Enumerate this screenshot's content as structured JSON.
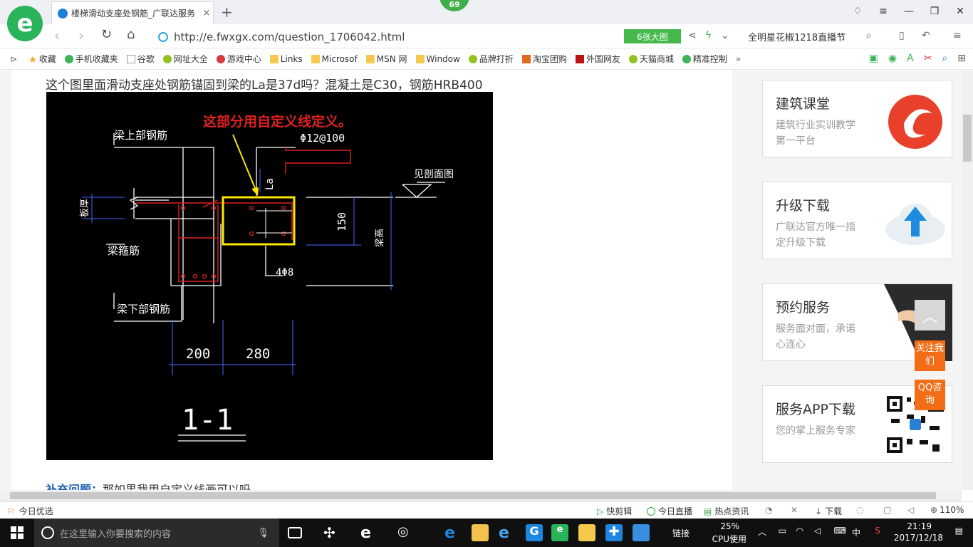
{
  "browser": {
    "tab_title": "楼梯滑动支座处钢筋_广联达服务",
    "tab_close": "×",
    "new_tab": "+",
    "badge": "69",
    "url": "http://e.fwxgx.com/question_1706042.html",
    "big_image_label": "6张大图",
    "hot_search": "全明星花椒1218直播节"
  },
  "bookmarks": [
    {
      "label": "收藏",
      "icon": "star-icon"
    },
    {
      "label": "手机收藏夹",
      "icon": "phone-icon"
    },
    {
      "label": "谷歌",
      "icon": "page-icon"
    },
    {
      "label": "网址大全",
      "icon": "globe-icon"
    },
    {
      "label": "游戏中心",
      "icon": "game-icon"
    },
    {
      "label": "Links",
      "icon": "folder-icon"
    },
    {
      "label": "Microsof",
      "icon": "folder-icon"
    },
    {
      "label": "MSN 网",
      "icon": "folder-icon"
    },
    {
      "label": "Window",
      "icon": "folder-icon"
    },
    {
      "label": "品牌打折",
      "icon": "leaf-icon"
    },
    {
      "label": "淘宝团购",
      "icon": "taobao-icon"
    },
    {
      "label": "外国网友",
      "icon": "flag-icon"
    },
    {
      "label": "天猫商城",
      "icon": "leaf-icon"
    },
    {
      "label": "精准控制",
      "icon": "wechat-icon"
    }
  ],
  "question": {
    "title": "这个图里面滑动支座处钢筋锚固到梁的La是37d吗？混凝土是C30，钢筋HRB400",
    "supplement_label": "补充问题：",
    "supplement_text": "那如果我用自定义线画可以吗"
  },
  "cad": {
    "note": "这部分用自定义线定义。",
    "label_top_rebar": "梁上部钢筋",
    "label_slab_thickness": "板厚",
    "label_stirrup": "梁箍筋",
    "label_bottom_rebar": "梁下部钢筋",
    "label_rebar_spec": "Φ12@100",
    "label_la": "La",
    "label_section_ref": "见剖面图",
    "label_150": "150",
    "label_beam_height": "梁高",
    "label_4phi8": "4Φ8",
    "dim_200": "200",
    "dim_280": "280",
    "section_mark": "1-1"
  },
  "sidebar": [
    {
      "title": "建筑课堂",
      "desc": "建筑行业实训教学第一平台"
    },
    {
      "title": "升级下载",
      "desc": "广联达官方唯一指定升级下载"
    },
    {
      "title": "预约服务",
      "desc": "服务面对面，承诺心连心"
    },
    {
      "title": "服务APP下载",
      "desc": "您的掌上服务专家"
    }
  ],
  "float_buttons": {
    "follow": "关注我们",
    "qq": "QQ咨询"
  },
  "statusbar": {
    "today_pick": "今日优选",
    "quick_clip": "快剪辑",
    "today_live": "今日直播",
    "hot_news": "热点资讯",
    "download": "下载",
    "zoom": "110%"
  },
  "taskbar": {
    "search_placeholder": "在这里输入你要搜索的内容",
    "link_label": "链接",
    "cpu_percent": "25%",
    "cpu_label": "CPU使用",
    "ime": "中",
    "time": "21:19",
    "date": "2017/12/18"
  }
}
